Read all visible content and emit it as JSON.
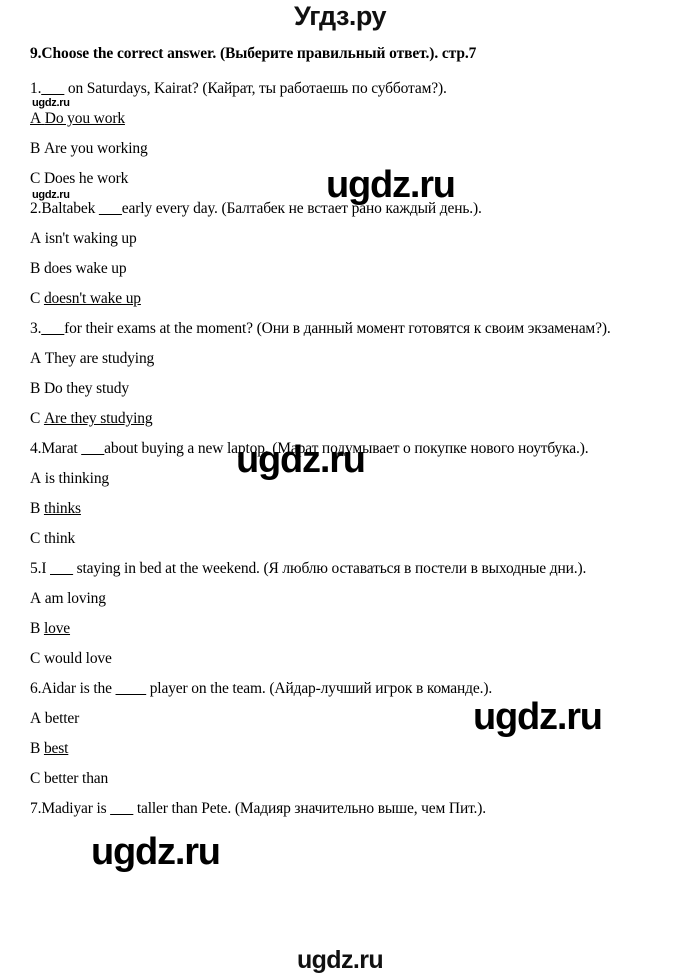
{
  "header": {
    "logo": "Угдз.ру"
  },
  "document": {
    "task_title": "9.Choose the correct answer. (Выберите правильный ответ.). стр.7",
    "questions": [
      {
        "number": "1.",
        "blank": "___",
        "stem_en_before": "1.",
        "stem_en_after": " on Saturdays, Kairat?",
        "stem_ru": "(Кайрат, ты работаешь по субботам?).",
        "options": [
          {
            "letter": "A",
            "text": "Do you work",
            "correct": true,
            "underline_letter": true
          },
          {
            "letter": "B",
            "text": "Are you working",
            "correct": false,
            "underline_letter": false
          },
          {
            "letter": "C",
            "text": "Does he work",
            "correct": false,
            "underline_letter": false
          }
        ]
      },
      {
        "number": "2.",
        "blank": "___",
        "stem_en_before": "2.Baltabek ",
        "stem_en_after": "early every day.",
        "stem_ru": "(Балтабек не встает рано каждый день.).",
        "options": [
          {
            "letter": "A",
            "text": "isn't waking up",
            "correct": false,
            "underline_letter": false
          },
          {
            "letter": "B",
            "text": "does wake up",
            "correct": false,
            "underline_letter": false
          },
          {
            "letter": "C",
            "text": "doesn't wake up",
            "correct": true,
            "underline_letter": false
          }
        ]
      },
      {
        "number": "3.",
        "blank": "___",
        "stem_en_before": "3.",
        "stem_en_after": "for their exams at the moment?",
        "stem_ru": "(Они в данный момент готовятся к своим экзаменам?).",
        "options": [
          {
            "letter": "A",
            "text": "They are studying",
            "correct": false,
            "underline_letter": false
          },
          {
            "letter": "B",
            "text": "Do they study",
            "correct": false,
            "underline_letter": false
          },
          {
            "letter": "C",
            "text": "Are they studying",
            "correct": true,
            "underline_letter": false
          }
        ]
      },
      {
        "number": "4.",
        "blank": "___",
        "stem_en_before": "4.Marat ",
        "stem_en_after": "about buying a  new laptop.",
        "stem_ru": "(Марат подумывает о покупке нового ноутбука.).",
        "options": [
          {
            "letter": "A",
            "text": "is thinking",
            "correct": false,
            "underline_letter": false
          },
          {
            "letter": "B",
            "text": "thinks",
            "correct": true,
            "underline_letter": false
          },
          {
            "letter": "C",
            "text": "think",
            "correct": false,
            "underline_letter": false
          }
        ]
      },
      {
        "number": "5.",
        "blank": "___",
        "stem_en_before": "5.I ",
        "stem_en_after": " staying in bed at the weekend.",
        "stem_ru": "(Я люблю оставаться в постели в выходные дни.).",
        "options": [
          {
            "letter": "A",
            "text": "am loving",
            "correct": false,
            "underline_letter": false
          },
          {
            "letter": "B",
            "text": "love",
            "correct": true,
            "underline_letter": false
          },
          {
            "letter": "C",
            "text": "would love",
            "correct": false,
            "underline_letter": false
          }
        ]
      },
      {
        "number": "6.",
        "blank": "____",
        "stem_en_before": "6.Aidar is the ",
        "stem_en_after": " player on the team.",
        "stem_ru": "(Айдар-лучший игрок в команде.).",
        "options": [
          {
            "letter": "A",
            "text": "better",
            "correct": false,
            "underline_letter": false
          },
          {
            "letter": "B",
            "text": "best",
            "correct": true,
            "underline_letter": false
          },
          {
            "letter": "C",
            "text": "better than",
            "correct": false,
            "underline_letter": false
          }
        ]
      },
      {
        "number": "7.",
        "blank": "___",
        "stem_en_before": "7.Madiyar is ",
        "stem_en_after": " taller than Pete.",
        "stem_ru": "(Мадияр значительно выше, чем Пит.).",
        "options": []
      }
    ]
  },
  "watermarks": {
    "big": "ugdz.ru",
    "small": "ugdz.ru",
    "bottom": "ugdz.ru"
  }
}
